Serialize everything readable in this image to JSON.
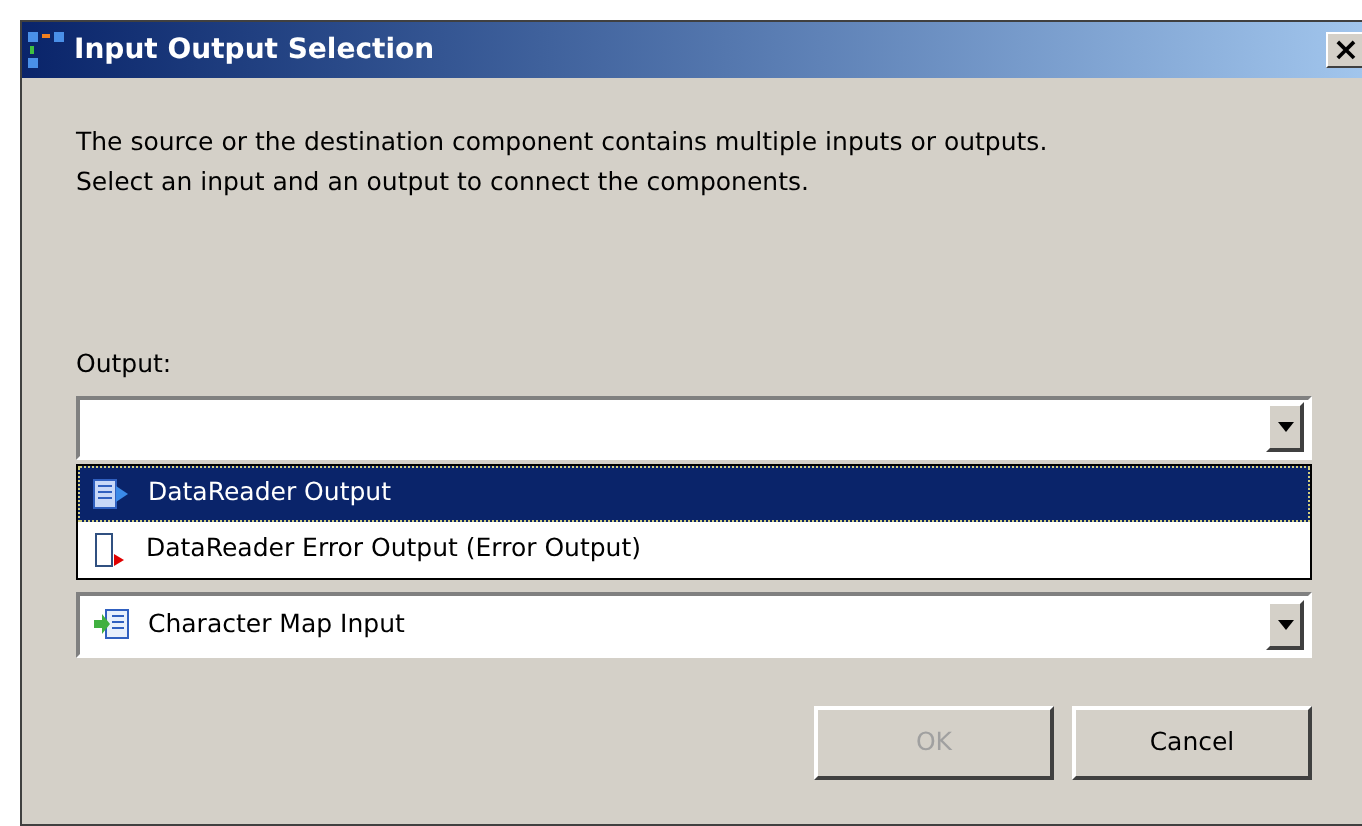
{
  "window": {
    "title": "Input Output Selection",
    "close": "×"
  },
  "description": [
    "The source or the destination component contains multiple inputs or outputs.",
    "Select an input and an output to connect the components."
  ],
  "output": {
    "label": "Output:",
    "expanded": true,
    "options": [
      {
        "label": "DataReader Output",
        "kind": "output",
        "selected": true
      },
      {
        "label": "DataReader Error Output (Error Output)",
        "kind": "error",
        "selected": false
      }
    ]
  },
  "input": {
    "value": "Character Map Input",
    "expanded": false
  },
  "buttons": [
    {
      "label": "OK",
      "disabled": true
    },
    {
      "label": "Cancel",
      "disabled": false
    }
  ]
}
